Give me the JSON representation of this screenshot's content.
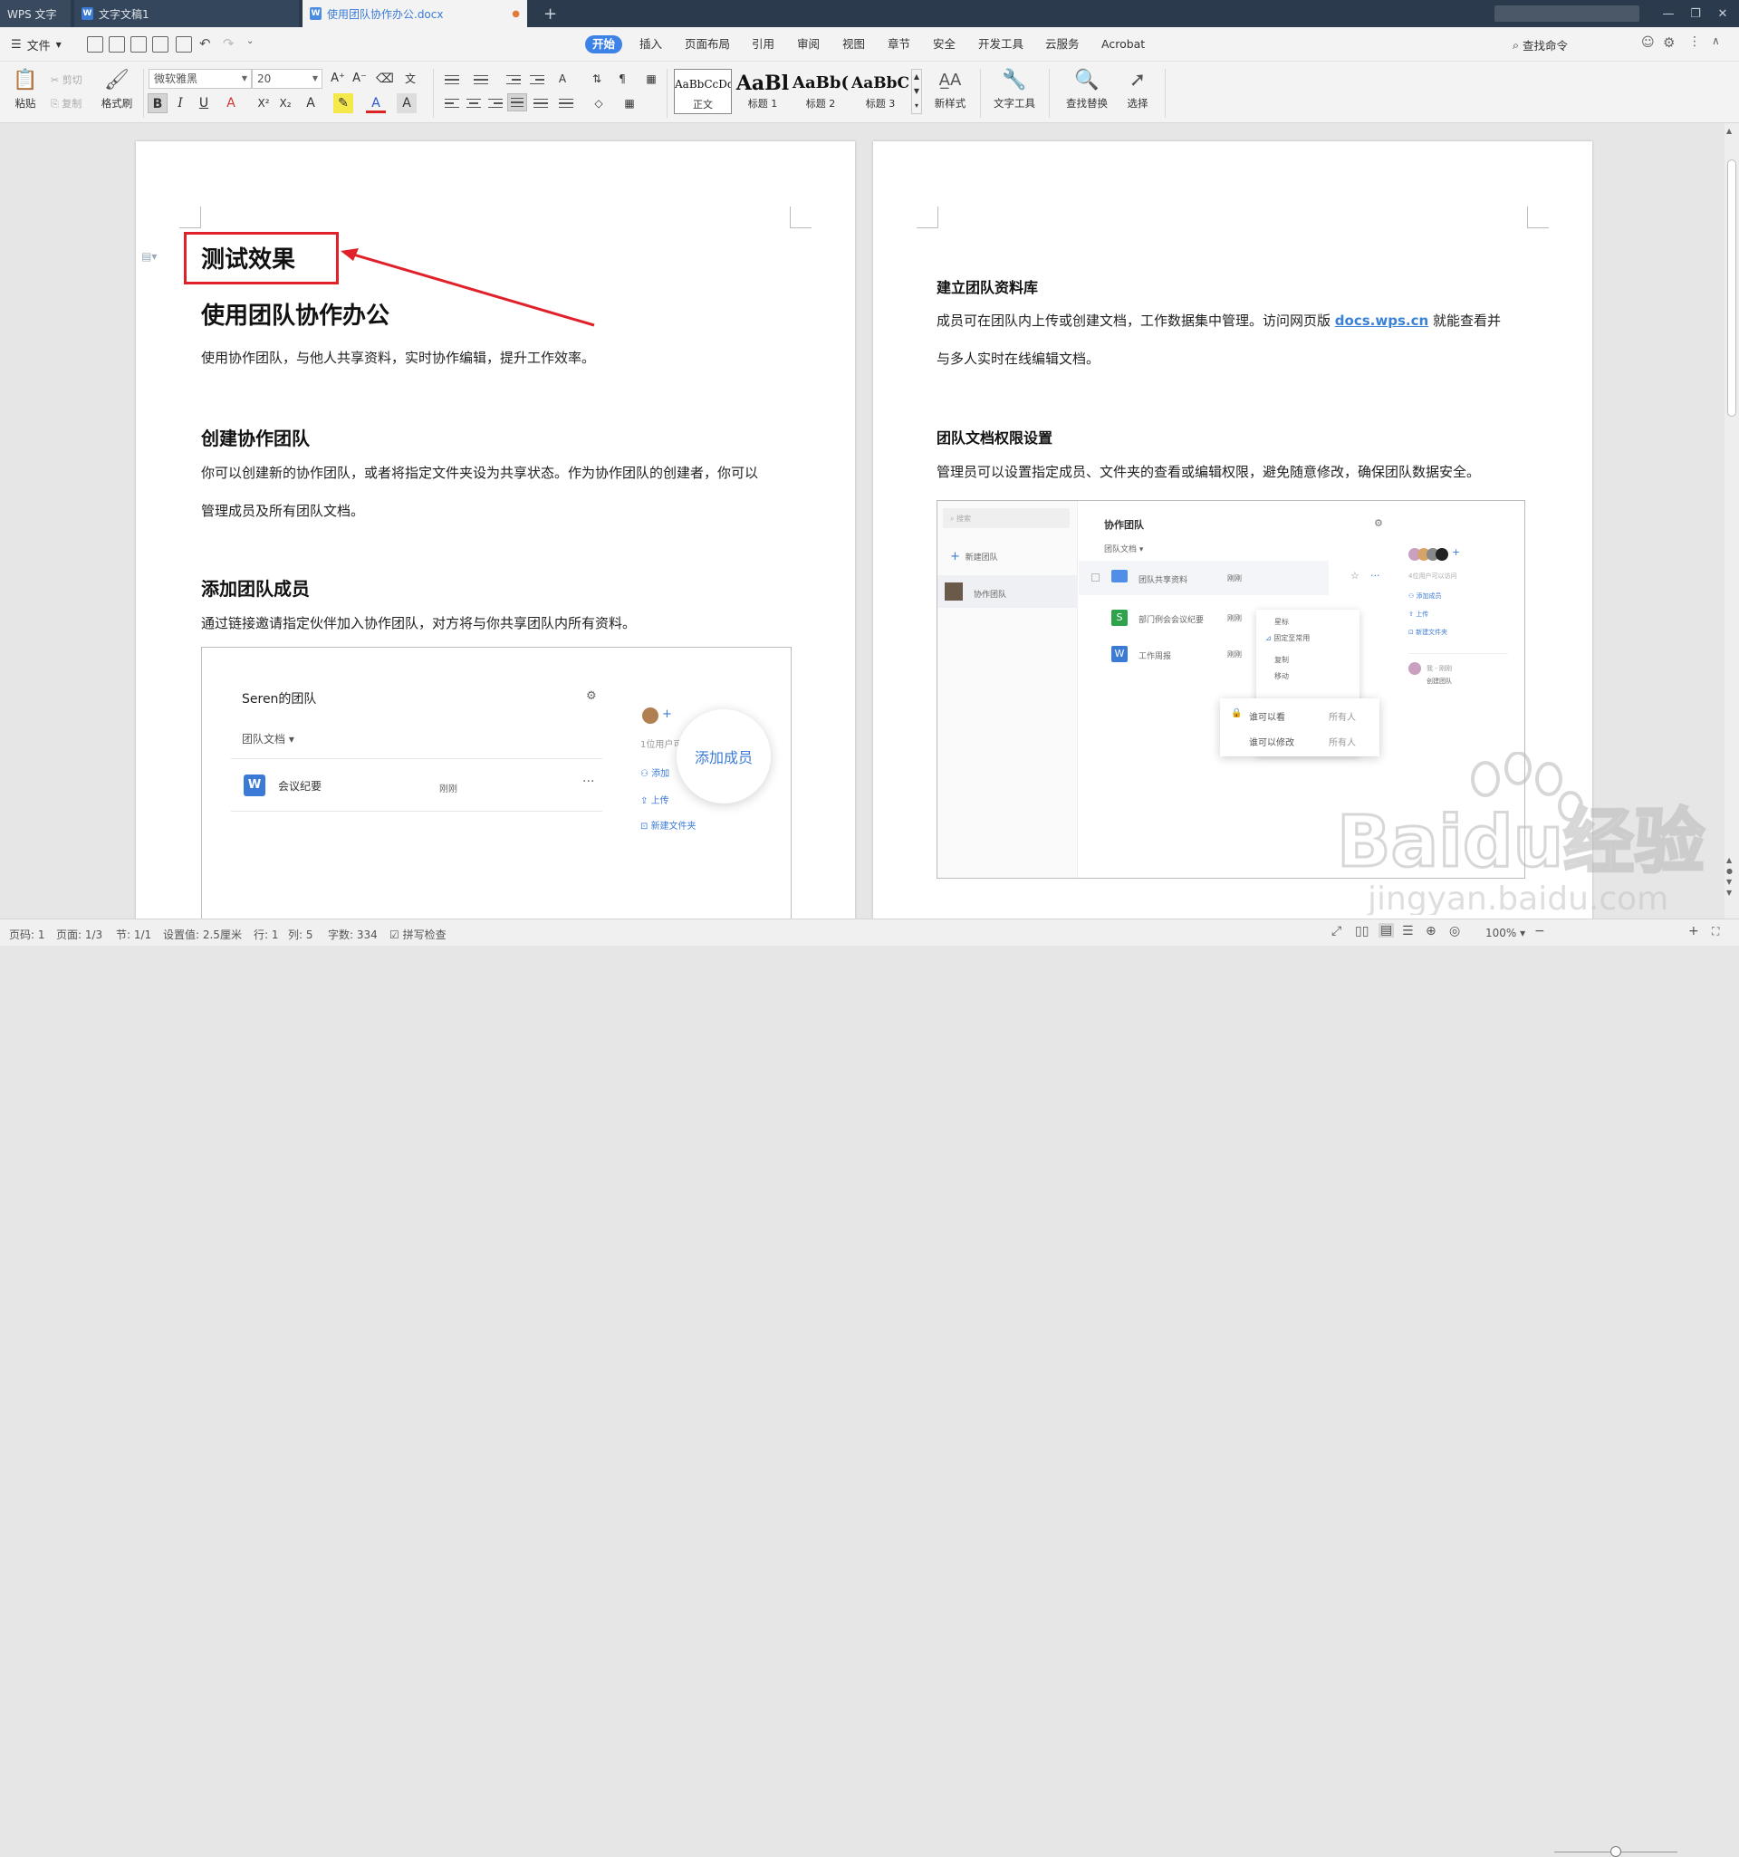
{
  "tabs": [
    {
      "label": "WPS 文字"
    },
    {
      "label": "文字文稿1"
    },
    {
      "label": "使用团队协作办公.docx"
    }
  ],
  "menu": {
    "file": "文件",
    "items": [
      "开始",
      "插入",
      "页面布局",
      "引用",
      "审阅",
      "视图",
      "章节",
      "安全",
      "开发工具",
      "云服务",
      "Acrobat"
    ],
    "search": "查找命令"
  },
  "ribbon": {
    "paste": "粘贴",
    "cut": "剪切",
    "copy": "复制",
    "format_painter": "格式刷",
    "font_name": "微软雅黑",
    "font_size": "20",
    "styles": [
      {
        "preview": "AaBbCcDd",
        "label": "正文"
      },
      {
        "preview": "AaBl",
        "label": "标题 1"
      },
      {
        "preview": "AaBb(",
        "label": "标题 2"
      },
      {
        "preview": "AaBbC",
        "label": "标题 3"
      }
    ],
    "new_style": "新样式",
    "text_tools": "文字工具",
    "find_replace": "查找替换",
    "select": "选择"
  },
  "page1": {
    "annot_title": "测试效果",
    "title": "使用团队协作办公",
    "intro": "使用协作团队，与他人共享资料，实时协作编辑，提升工作效率。",
    "s1_title": "创建协作团队",
    "s1_line1": "你可以创建新的协作团队，或者将指定文件夹设为共享状态。作为协作团队的创建者，你可以",
    "s1_line2": "管理成员及所有团队文档。",
    "s2_title": "添加团队成员",
    "s2_body": "通过链接邀请指定伙伴加入协作团队，对方将与你共享团队内所有资料。",
    "img": {
      "team": "Seren的团队",
      "docs": "团队文档",
      "file": "会议纪要",
      "time": "刚刚",
      "users": "1位用户可",
      "add": "添加",
      "upload": "上传",
      "new_folder": "新建文件夹",
      "bubble": "添加成员"
    }
  },
  "page2": {
    "s1_title": "建立团队资料库",
    "s1_line1a": "成员可在团队内上传或创建文档，工作数据集中管理。访问网页版",
    "s1_link": "docs.wps.cn",
    "s1_line1b": "就能查看并",
    "s1_line2": "与多人实时在线编辑文档。",
    "s2_title": "团队文档权限设置",
    "s2_body": "管理员可以设置指定成员、文件夹的查看或编辑权限，避免随意修改，确保团队数据安全。",
    "img": {
      "search": "搜索",
      "new_team": "新建团队",
      "collab_team": "协作团队",
      "header": "协作团队",
      "docs": "团队文档",
      "files": [
        "团队共享资料",
        "部门例会会议纪要",
        "工作周报"
      ],
      "time": "刚刚",
      "menu": [
        "星标",
        "固定至常用",
        "复制",
        "移动"
      ],
      "perm_view": "谁可以看",
      "perm_edit": "谁可以修改",
      "perm_all": "所有人",
      "users": "4位用户可以访问",
      "add_member": "添加成员",
      "upload": "上传",
      "new_folder": "新建文件夹",
      "me": "我 - 刚刚",
      "created": "创建团队"
    }
  },
  "status": {
    "page": "页码: 1",
    "pages": "页面: 1/3",
    "section": "节: 1/1",
    "setting": "设置值: 2.5厘米",
    "row": "行: 1",
    "col": "列: 5",
    "words": "字数: 334",
    "spell": "拼写检查",
    "zoom": "100%",
    "zoom_level": 0.5
  },
  "watermark": {
    "brand": "Baidu经验",
    "url": "jingyan.baidu.com"
  },
  "colors": {
    "accent": "#3d82e6",
    "annotation": "#e0202a",
    "link": "#3b82d6"
  }
}
